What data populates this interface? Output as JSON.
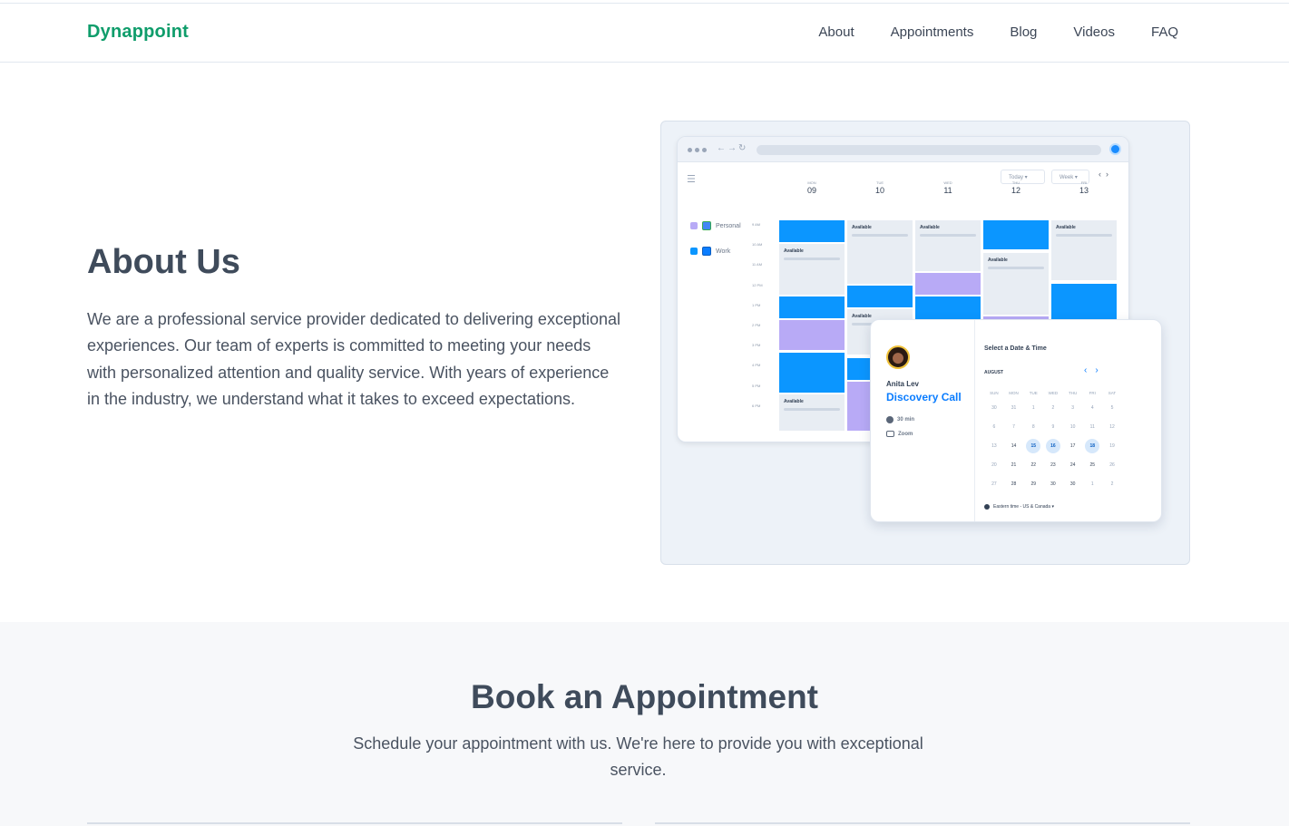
{
  "header": {
    "logo": "Dynappoint",
    "nav": [
      "About",
      "Appointments",
      "Blog",
      "Videos",
      "FAQ"
    ]
  },
  "about": {
    "title": "About Us",
    "text": "We are a professional service provider dedicated to delivering exceptional experiences. Our team of experts is committed to meeting your needs with personalized attention and quality service. With years of experience in the industry, we understand what it takes to exceed expectations."
  },
  "illustration": {
    "toolbar": {
      "today": "Today",
      "week": "Week"
    },
    "calendars": [
      "Personal",
      "Work"
    ],
    "days": [
      {
        "name": "MON",
        "num": "09"
      },
      {
        "name": "TUE",
        "num": "10"
      },
      {
        "name": "WED",
        "num": "11"
      },
      {
        "name": "THU",
        "num": "12"
      },
      {
        "name": "FRI",
        "num": "13"
      }
    ],
    "hours": [
      "9 AM",
      "10 AM",
      "11 AM",
      "12 PM",
      "1 PM",
      "2 PM",
      "3 PM",
      "4 PM",
      "5 PM",
      "6 PM"
    ],
    "available_label": "Available",
    "colors": {
      "blue": "#0b96ff",
      "purple": "#b8aaf6",
      "brand_green": "#0f9d6b"
    },
    "booking": {
      "host": "Anita Lev",
      "event": "Discovery Call",
      "duration": "30 min",
      "location": "Zoom",
      "prompt": "Select a Date & Time",
      "month": "AUGUST",
      "weekdays": [
        "SUN",
        "MON",
        "TUE",
        "WED",
        "THU",
        "FRI",
        "SAT"
      ],
      "weeks": [
        [
          "30",
          "31",
          "1",
          "2",
          "3",
          "4",
          "5"
        ],
        [
          "6",
          "7",
          "8",
          "9",
          "10",
          "11",
          "12"
        ],
        [
          "13",
          "14",
          "15",
          "16",
          "17",
          "18",
          "19"
        ],
        [
          "20",
          "21",
          "22",
          "23",
          "24",
          "25",
          "26"
        ],
        [
          "27",
          "28",
          "29",
          "30",
          "30",
          "1",
          "2"
        ]
      ],
      "highlighted_days": [
        "15",
        "16",
        "18"
      ],
      "timezone": "Eastern time - US & Canada ▾"
    }
  },
  "book": {
    "title": "Book an Appointment",
    "subtitle": "Schedule your appointment with us. We're here to provide you with exceptional service."
  }
}
